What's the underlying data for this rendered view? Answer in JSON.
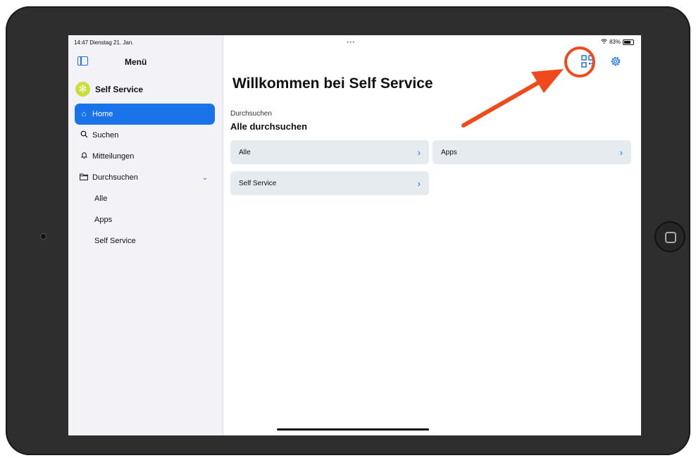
{
  "status": {
    "time_date": "14:47  Dienstag 21. Jan.",
    "dots": "•••",
    "battery": "83%"
  },
  "sidebar": {
    "title": "Menü",
    "brand": "Self Service",
    "items": [
      {
        "label": "Home",
        "icon": "house-icon"
      },
      {
        "label": "Suchen",
        "icon": "search-icon"
      },
      {
        "label": "Mitteilungen",
        "icon": "bell-icon"
      },
      {
        "label": "Durchsuchen",
        "icon": "folder-icon"
      }
    ],
    "subitems": [
      "Alle",
      "Apps",
      "Self Service"
    ]
  },
  "main": {
    "title": "Willkommen bei Self Service",
    "section_label": "Durchsuchen",
    "section_title": "Alle durchsuchen",
    "cards": [
      {
        "label": "Alle"
      },
      {
        "label": "Apps"
      },
      {
        "label": "Self Service"
      }
    ]
  },
  "colors": {
    "accent": "#1a73e8",
    "annotation": "#ee4a1c",
    "card": "#e5ebee",
    "sidebar": "#f2f2f7",
    "brand": "#c9e03b"
  }
}
